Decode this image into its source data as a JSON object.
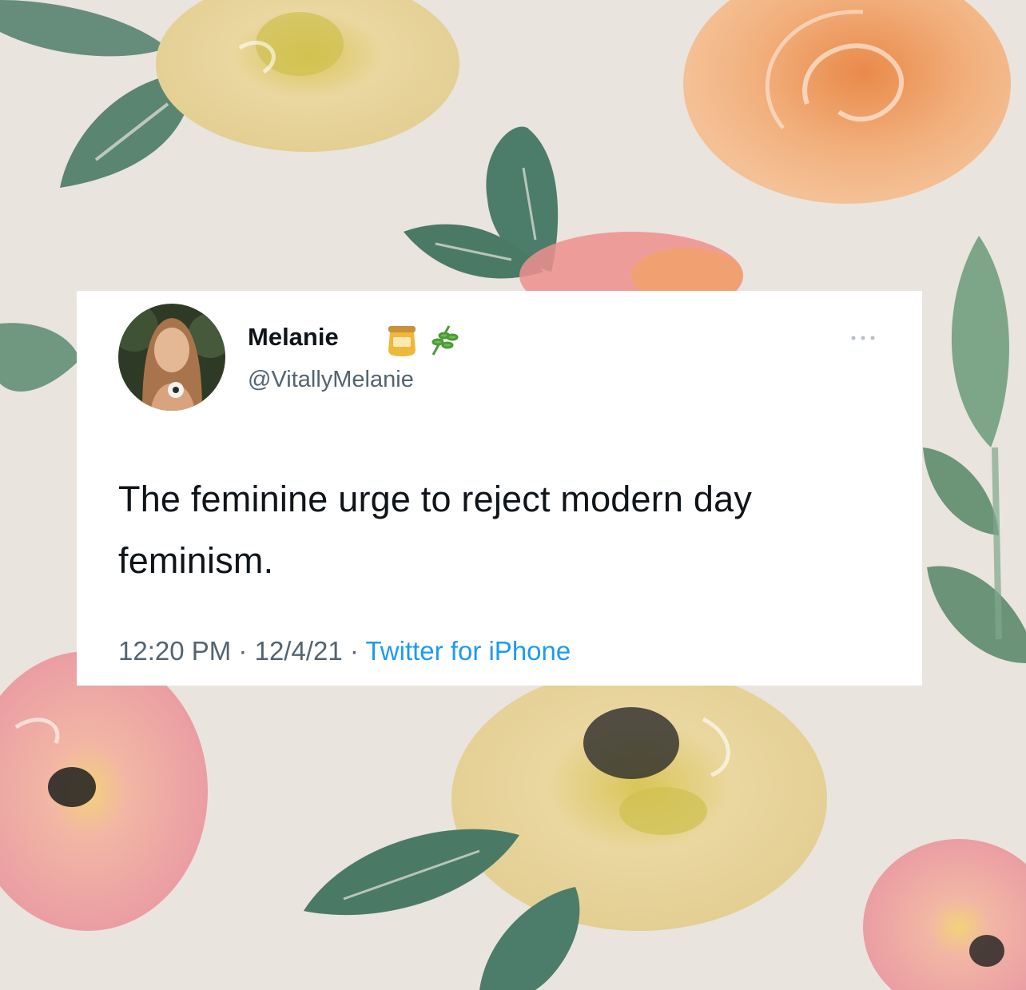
{
  "tweet": {
    "display_name": "Melanie",
    "name_emojis": [
      "honey-pot-icon",
      "herb-icon"
    ],
    "handle": "@VitallyMelanie",
    "text": "The feminine urge to reject modern day feminism.",
    "time": "12:20 PM",
    "date": "12/4/21",
    "separator": "·",
    "source": "Twitter for iPhone",
    "more_icon": "ellipsis-icon"
  },
  "colors": {
    "background": "#e9e4de",
    "card": "#ffffff",
    "text_primary": "#0f1419",
    "text_secondary": "#536471",
    "link": "#1d9bf0"
  }
}
